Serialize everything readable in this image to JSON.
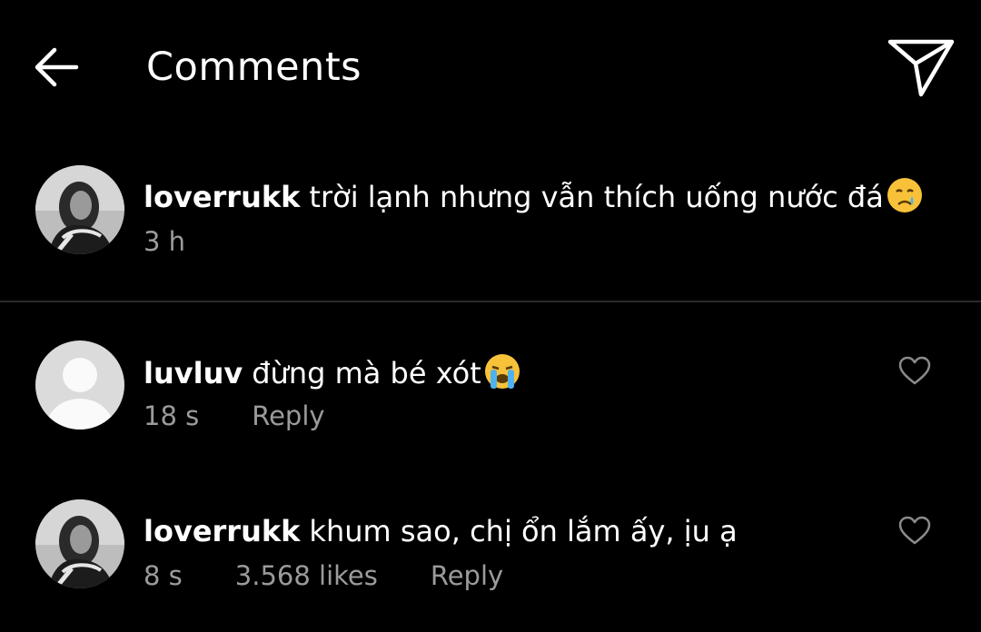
{
  "header": {
    "title": "Comments",
    "back_icon": "arrow-left-icon",
    "share_icon": "paper-plane-icon"
  },
  "caption": {
    "username": "loverrukk",
    "text": "trời lạnh nhưng vẫn thích uống nước đá",
    "emoji": "😢",
    "time": "3 h"
  },
  "comments": [
    {
      "username": "luvluv",
      "text": "đừng mà bé xót",
      "emoji": "😭",
      "time": "18 s",
      "reply_label": "Reply",
      "avatar": "default-avatar"
    },
    {
      "username": "loverrukk",
      "text": "khum sao, chị ổn lắm ấy, ịu ạ",
      "time": "8 s",
      "likes": "3.568 likes",
      "reply_label": "Reply",
      "avatar": "profile-photo"
    }
  ],
  "colors": {
    "background": "#000000",
    "text": "#ffffff",
    "meta": "#9b9b9b",
    "divider": "#2b2b2b"
  }
}
